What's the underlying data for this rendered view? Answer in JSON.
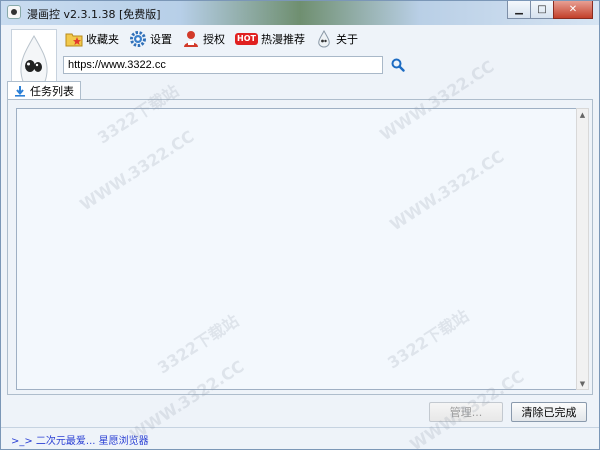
{
  "window": {
    "title": "漫画控 v2.3.1.38 [免费版]",
    "min_glyph": "▁",
    "max_glyph": "□",
    "close_glyph": "✕"
  },
  "toolbar": {
    "items": [
      {
        "label": "收藏夹",
        "icon": "favorites-folder-icon"
      },
      {
        "label": "设置",
        "icon": "gear-icon"
      },
      {
        "label": "授权",
        "icon": "vip-user-icon"
      },
      {
        "label": "热漫推荐",
        "icon": "hot-badge-icon",
        "badge": "HOT"
      },
      {
        "label": "关于",
        "icon": "about-icon"
      }
    ]
  },
  "search": {
    "value": "https://www.3322.cc",
    "icon": "search-icon"
  },
  "tabs": [
    {
      "label": "任务列表",
      "icon": "download-icon",
      "active": true
    }
  ],
  "task_list": {
    "items": []
  },
  "buttons": {
    "manage": "管理...",
    "clear_completed": "清除已完成"
  },
  "status": {
    "link_text": ">_> 二次元最爱... 星愿浏览器"
  },
  "watermark": {
    "text_a": "WWW.3322.CC",
    "text_b": "3322下载站"
  },
  "colors": {
    "accent": "#2a3fd4",
    "hot": "#e02020",
    "background": "#eef3f9"
  }
}
